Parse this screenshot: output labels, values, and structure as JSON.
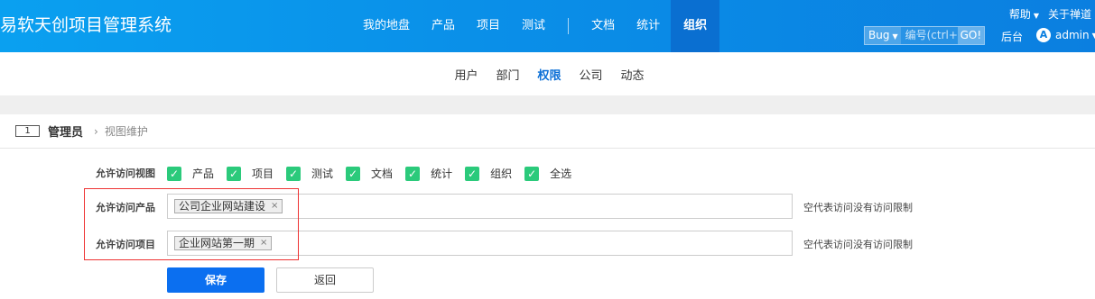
{
  "app": {
    "title": "易软天创项目管理系统"
  },
  "main_nav": [
    {
      "label": "我的地盘"
    },
    {
      "label": "产品"
    },
    {
      "label": "项目"
    },
    {
      "label": "测试"
    },
    {
      "label": "文档"
    },
    {
      "label": "统计"
    },
    {
      "label": "组织",
      "active": true
    }
  ],
  "top_links": {
    "help": "帮助",
    "about": "关于禅道"
  },
  "search": {
    "type": "Bug",
    "placeholder": "编号(ctrl+g",
    "go": "GO!"
  },
  "backend_label": "后台",
  "user": {
    "avatar_letter": "A",
    "name": "admin"
  },
  "sub_nav": [
    {
      "label": "用户"
    },
    {
      "label": "部门"
    },
    {
      "label": "权限",
      "active": true
    },
    {
      "label": "公司"
    },
    {
      "label": "动态"
    }
  ],
  "breadcrumb": {
    "id": "1",
    "group": "管理员",
    "page": "视图维护"
  },
  "form": {
    "views_label": "允许访问视图",
    "views": [
      {
        "label": "产品",
        "checked": true
      },
      {
        "label": "项目",
        "checked": true
      },
      {
        "label": "测试",
        "checked": true
      },
      {
        "label": "文档",
        "checked": true
      },
      {
        "label": "统计",
        "checked": true
      },
      {
        "label": "组织",
        "checked": true
      },
      {
        "label": "全选",
        "checked": true
      }
    ],
    "products_label": "允许访问产品",
    "products_chip": "公司企业网站建设",
    "products_hint": "空代表访问没有访问限制",
    "projects_label": "允许访问项目",
    "projects_chip": "企业网站第一期",
    "projects_hint": "空代表访问没有访问限制",
    "remove_glyph": "×",
    "check_glyph": "✓",
    "save_label": "保存",
    "back_label": "返回"
  },
  "colors": {
    "accent": "#0b6ff0",
    "check": "#2bca7b",
    "highlight_box": "#e33"
  }
}
